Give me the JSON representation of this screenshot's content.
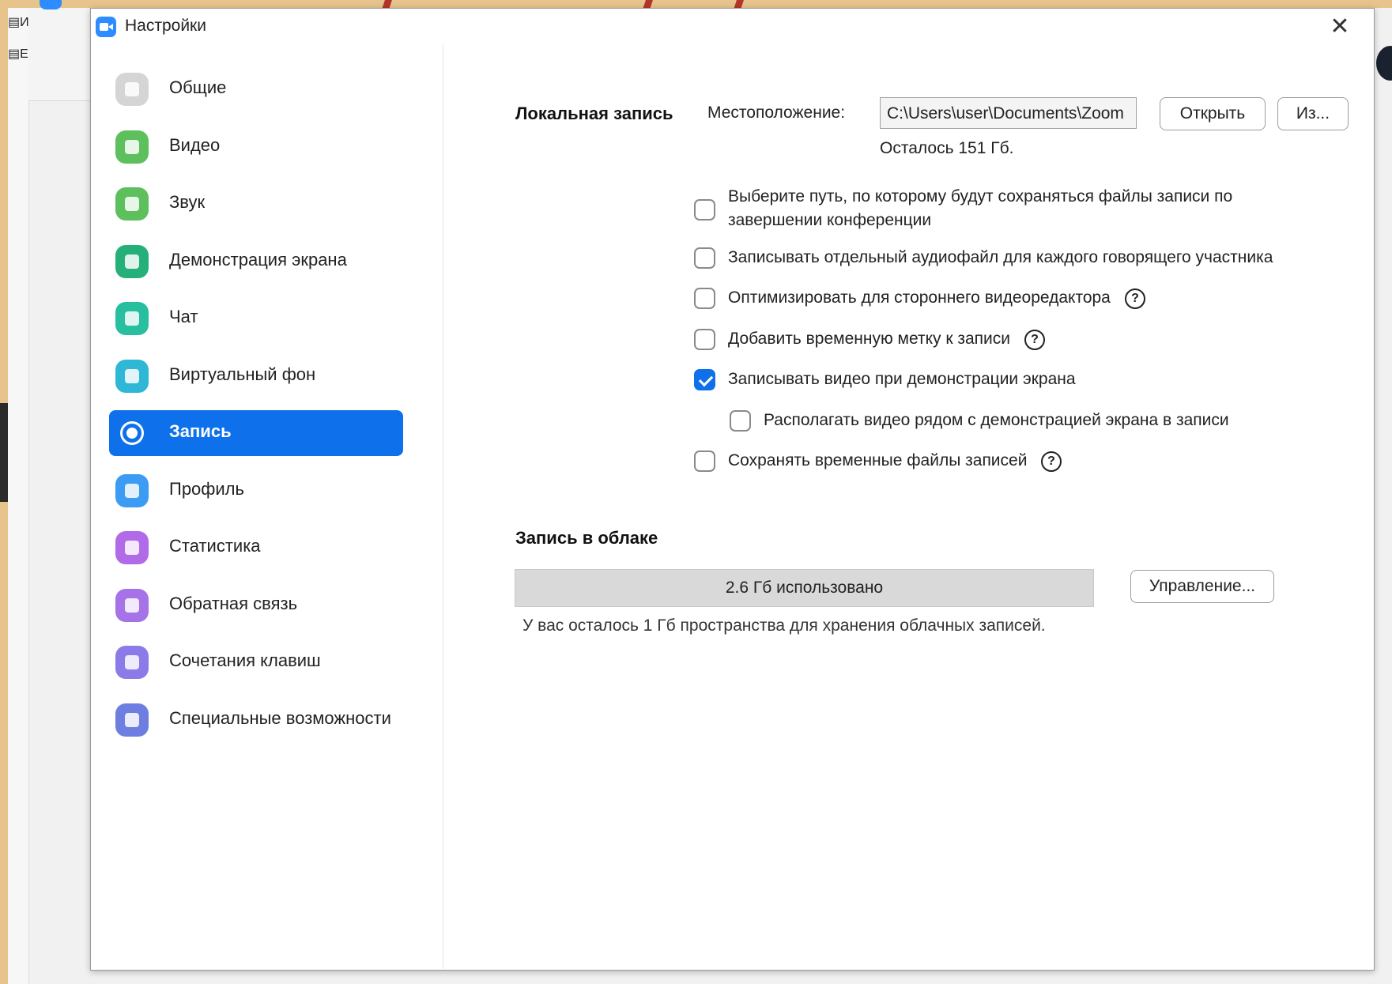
{
  "window": {
    "title": "Настройки",
    "close_glyph": "✕"
  },
  "background": {
    "file_items": [
      "И",
      "Е"
    ]
  },
  "sidebar": {
    "items": [
      {
        "label": "Общие",
        "icon": "gear-icon",
        "color": "#d5d5d5"
      },
      {
        "label": "Видео",
        "icon": "video-camera-icon",
        "color": "#5ec05c"
      },
      {
        "label": "Звук",
        "icon": "headphones-icon",
        "color": "#5ec05c"
      },
      {
        "label": "Демонстрация экрана",
        "icon": "share-screen-icon",
        "color": "#25b07a"
      },
      {
        "label": "Чат",
        "icon": "chat-icon",
        "color": "#27bfa0"
      },
      {
        "label": "Виртуальный фон",
        "icon": "virtual-background-icon",
        "color": "#2fb7d6"
      },
      {
        "label": "Запись",
        "icon": "record-icon",
        "color": "#0e71eb",
        "active": true
      },
      {
        "label": "Профиль",
        "icon": "profile-icon",
        "color": "#3c9bf2"
      },
      {
        "label": "Статистика",
        "icon": "statistics-icon",
        "color": "#b26be8"
      },
      {
        "label": "Обратная связь",
        "icon": "feedback-icon",
        "color": "#a672e8"
      },
      {
        "label": "Сочетания клавиш",
        "icon": "keyboard-icon",
        "color": "#8b7be8"
      },
      {
        "label": "Специальные возможности",
        "icon": "accessibility-icon",
        "color": "#6d7ee0"
      }
    ]
  },
  "local_recording": {
    "title": "Локальная запись",
    "location_label": "Местоположение:",
    "path": "C:\\Users\\user\\Documents\\Zoom",
    "open_button": "Открыть",
    "change_button": "Из...",
    "free_space": "Осталось 151 Гб.",
    "options": [
      {
        "label_lines": [
          "Выберите путь, по которому будут сохраняться файлы записи по",
          "завершении конференции"
        ],
        "checked": false,
        "help": false
      },
      {
        "label_lines": [
          "Записывать отдельный аудиофайл для каждого говорящего участника"
        ],
        "checked": false,
        "help": false
      },
      {
        "label_lines": [
          "Оптимизировать для стороннего видеоредактора"
        ],
        "checked": false,
        "help": true
      },
      {
        "label_lines": [
          "Добавить временную метку к записи"
        ],
        "checked": false,
        "help": true
      },
      {
        "label_lines": [
          "Записывать видео при демонстрации экрана"
        ],
        "checked": true,
        "help": false
      },
      {
        "label_lines": [
          "Располагать видео рядом с демонстрацией экрана в записи"
        ],
        "checked": false,
        "help": false,
        "indent": true
      },
      {
        "label_lines": [
          "Сохранять временные файлы записей"
        ],
        "checked": false,
        "help": true
      }
    ],
    "help_glyph": "?"
  },
  "cloud_recording": {
    "title": "Запись в облаке",
    "usage_text": "2.6 Гб использовано",
    "manage_button": "Управление...",
    "note": "У вас осталось 1 Гб пространства для хранения облачных записей."
  },
  "colors": {
    "accent": "#0e71eb",
    "brand": "#2d8cff"
  }
}
